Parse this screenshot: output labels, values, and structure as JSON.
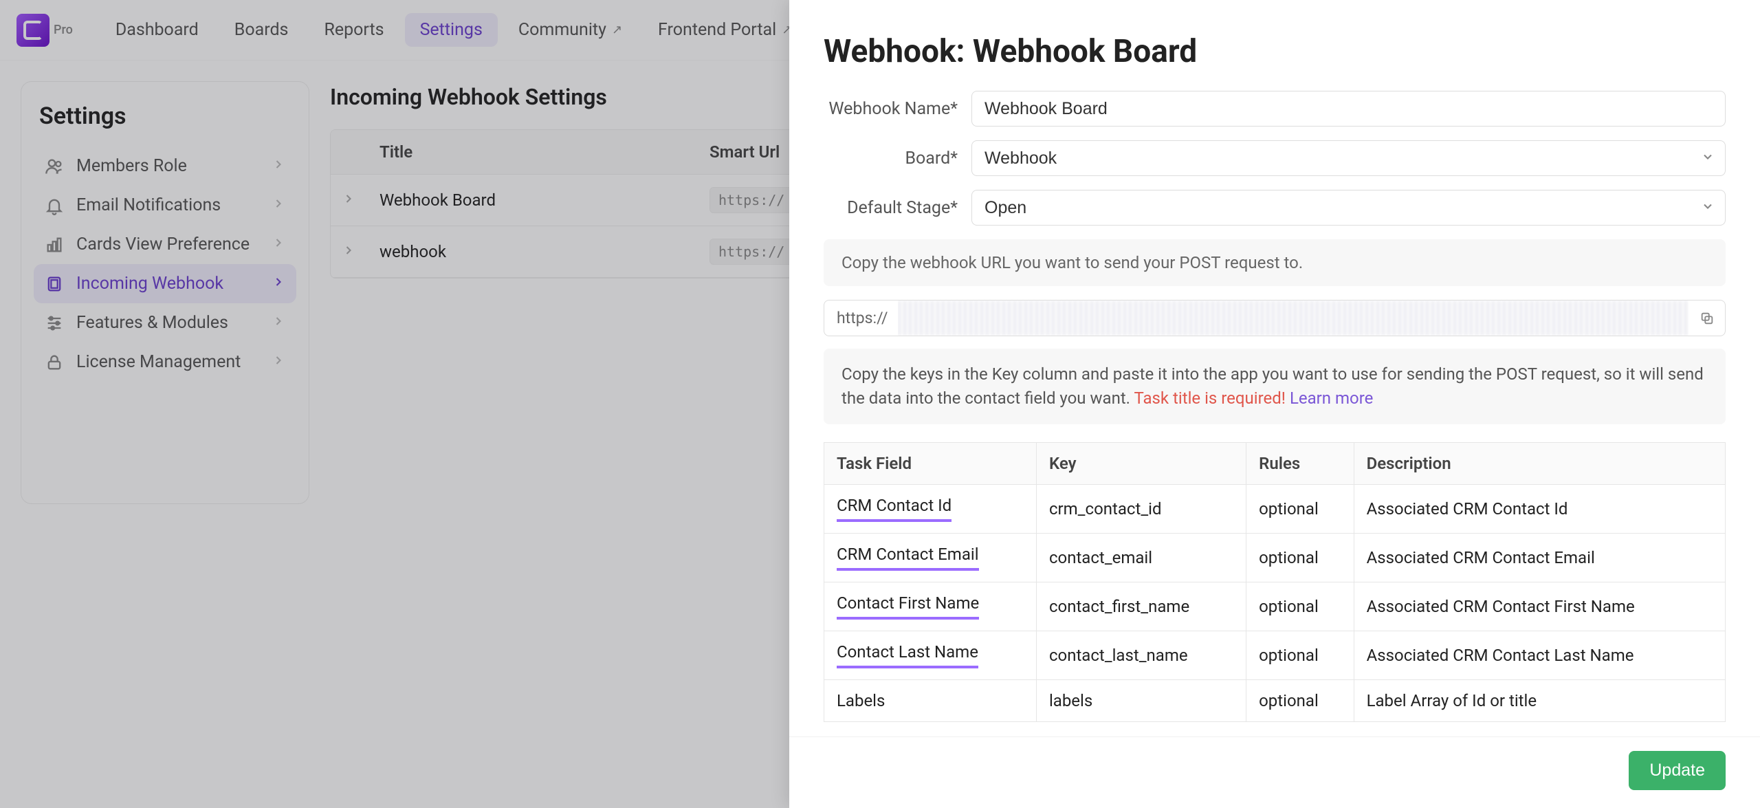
{
  "topnav": {
    "badge": "Pro",
    "items": [
      {
        "label": "Dashboard",
        "external": false
      },
      {
        "label": "Boards",
        "external": false
      },
      {
        "label": "Reports",
        "external": false
      },
      {
        "label": "Settings",
        "external": false,
        "active": true
      },
      {
        "label": "Community",
        "external": true
      },
      {
        "label": "Frontend Portal",
        "external": true
      }
    ]
  },
  "sidebar": {
    "title": "Settings",
    "items": [
      {
        "label": "Members Role",
        "icon": "users-icon"
      },
      {
        "label": "Email Notifications",
        "icon": "bell-icon"
      },
      {
        "label": "Cards View Preference",
        "icon": "bar-chart-icon"
      },
      {
        "label": "Incoming Webhook",
        "icon": "webhook-icon",
        "active": true
      },
      {
        "label": "Features & Modules",
        "icon": "sliders-icon"
      },
      {
        "label": "License Management",
        "icon": "lock-icon"
      }
    ]
  },
  "main": {
    "title": "Incoming Webhook Settings",
    "columns": {
      "title": "Title",
      "url": "Smart Url"
    },
    "rows": [
      {
        "title": "Webhook Board",
        "url_prefix": "https://"
      },
      {
        "title": "webhook",
        "url_prefix": "https://"
      }
    ]
  },
  "panel": {
    "title": "Webhook: Webhook Board",
    "form": {
      "name_label": "Webhook Name*",
      "name_value": "Webhook Board",
      "board_label": "Board*",
      "board_value": "Webhook",
      "stage_label": "Default Stage*",
      "stage_value": "Open"
    },
    "hint_url": "Copy the webhook URL you want to send your POST request to.",
    "url_prefix": "https://",
    "keys_text_1": "Copy the keys in the Key column and paste it into the app you want to use for sending the POST request, so it will send the data into the contact field you want. ",
    "keys_text_req": "Task title is required!",
    "keys_text_learn": "Learn more",
    "table": {
      "headers": {
        "task_field": "Task Field",
        "key": "Key",
        "rules": "Rules",
        "description": "Description"
      },
      "rows": [
        {
          "task_field": "CRM Contact Id",
          "key": "crm_contact_id",
          "rules": "optional",
          "description": "Associated CRM Contact Id",
          "accent": true
        },
        {
          "task_field": "CRM Contact Email",
          "key": "contact_email",
          "rules": "optional",
          "description": "Associated CRM Contact Email",
          "accent": true
        },
        {
          "task_field": "Contact First Name",
          "key": "contact_first_name",
          "rules": "optional",
          "description": "Associated CRM Contact First Name",
          "accent": true
        },
        {
          "task_field": "Contact Last Name",
          "key": "contact_last_name",
          "rules": "optional",
          "description": "Associated CRM Contact Last Name",
          "accent": true
        },
        {
          "task_field": "Labels",
          "key": "labels",
          "rules": "optional",
          "description": "Label Array of Id or title",
          "accent": false
        }
      ]
    },
    "update_label": "Update"
  }
}
